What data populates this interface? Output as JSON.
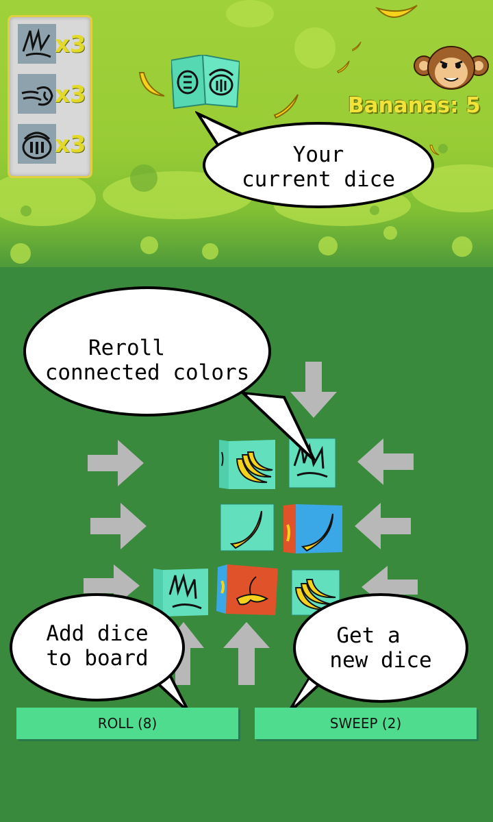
{
  "inventory": [
    {
      "icon": "scribble-face-icon",
      "count": "x3"
    },
    {
      "icon": "wind-face-icon",
      "count": "x3"
    },
    {
      "icon": "shell-face-icon",
      "count": "x3"
    }
  ],
  "score": {
    "label": "Bananas: 5",
    "icon": "monkey-icon"
  },
  "current_dice_icon": "current-die-icon",
  "bubbles": {
    "current": [
      "Your",
      "current dice"
    ],
    "reroll": [
      "Reroll",
      "connected colors"
    ],
    "add": [
      "Add dice",
      "to board"
    ],
    "sweep": [
      "Get a",
      "new dice"
    ]
  },
  "board": [
    {
      "face": "banana-bunch",
      "color": "teal"
    },
    {
      "face": "scribble",
      "color": "teal"
    },
    {
      "face": "banana",
      "color": "teal"
    },
    {
      "face": "banana",
      "color": "blue-red"
    },
    {
      "face": "scribble",
      "color": "teal"
    },
    {
      "face": "banana-peel",
      "color": "red"
    },
    {
      "face": "banana-bunch",
      "color": "teal"
    }
  ],
  "buttons": {
    "roll": "ROLL (8)",
    "sweep": "SWEEP (2)"
  },
  "colors": {
    "accent_button": "#4fdc8f",
    "background": "#3a8a3e",
    "score_text": "#f2e33a",
    "die_teal": "#62e0bd"
  }
}
